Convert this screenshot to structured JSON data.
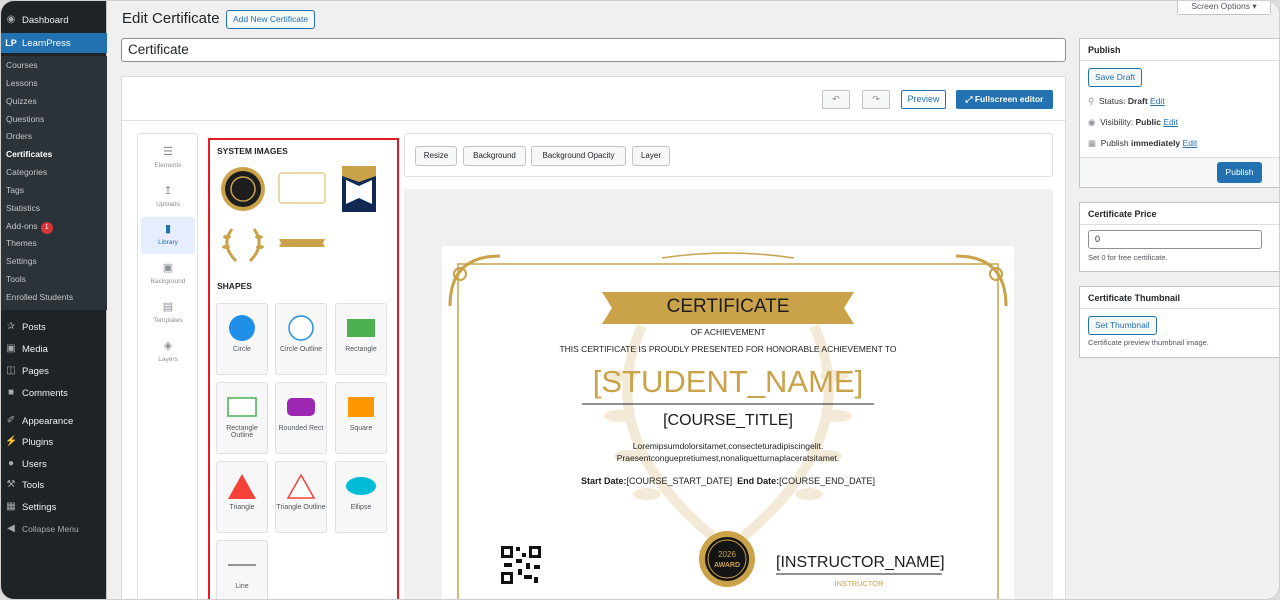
{
  "sidebar": {
    "dashboard": "Dashboard",
    "learnpress": "LearnPress",
    "subitems": [
      "Courses",
      "Lessons",
      "Quizzes",
      "Questions",
      "Orders",
      "Certificates",
      "Categories",
      "Tags",
      "Statistics",
      "Add-ons",
      "Themes",
      "Settings",
      "Tools",
      "Enrolled Students"
    ],
    "addons_badge": "1",
    "menu": [
      "Posts",
      "Media",
      "Pages",
      "Comments",
      "Appearance",
      "Plugins",
      "Users",
      "Tools",
      "Settings",
      "Collapse Menu"
    ]
  },
  "header": {
    "title": "Edit Certificate",
    "add_new": "Add New Certificate",
    "screen_options": "Screen Options",
    "cert_title": "Certificate"
  },
  "toolbar": {
    "preview": "Preview",
    "fullscreen": "Fullscreen editor"
  },
  "tools": [
    "Elements",
    "Uploads",
    "Library",
    "Background",
    "Templates",
    "Layers"
  ],
  "library": {
    "system_images_heading": "SYSTEM IMAGES",
    "shapes_heading": "SHAPES",
    "shapes": [
      "Circle",
      "Circle Outline",
      "Rectangle",
      "Rectangle Outline",
      "Rounded Rect",
      "Square",
      "Triangle",
      "Triangle Outline",
      "Ellipse",
      "Line"
    ]
  },
  "options": [
    "Resize",
    "Background",
    "Background Opacity",
    "Layer"
  ],
  "certificate": {
    "title": "CERTIFICATE",
    "subtitle": "OF ACHIEVEMENT",
    "presented": "THIS CERTIFICATE IS PROUDLY PRESENTED FOR HONORABLE ACHIEVEMENT TO",
    "student": "[STUDENT_NAME]",
    "course": "[COURSE_TITLE]",
    "lorem1": "Loremipsumdolorsitamet,consecteturadipiscingelit.",
    "lorem2": "Praesentconguepretiumest,nonaliquetturnaplaceratsitamet.",
    "start_label": "Start Date:",
    "start_val": "[COURSE_START_DATE]",
    "end_label": "End Date:",
    "end_val": "[COURSE_END_DATE]",
    "instructor": "[INSTRUCTOR_NAME]",
    "instructor_label": "INSTRUCTOR",
    "award_year": "2026",
    "award_text": "AWARD"
  },
  "publish": {
    "heading": "Publish",
    "save_draft": "Save Draft",
    "status_label": "Status:",
    "status_val": "Draft",
    "visibility_label": "Visibility:",
    "visibility_val": "Public",
    "publish_label": "Publish",
    "publish_val": "immediately",
    "edit": "Edit",
    "publish_btn": "Publish"
  },
  "price": {
    "heading": "Certificate Price",
    "value": "0",
    "help": "Set 0 for free certificate."
  },
  "thumbnail": {
    "heading": "Certificate Thumbnail",
    "set_btn": "Set Thumbnail",
    "help": "Certificate preview thumbnail image."
  },
  "colors": {
    "wp_blue": "#2271b1",
    "gold": "#c9a24a",
    "highlight": "#e31b23"
  }
}
